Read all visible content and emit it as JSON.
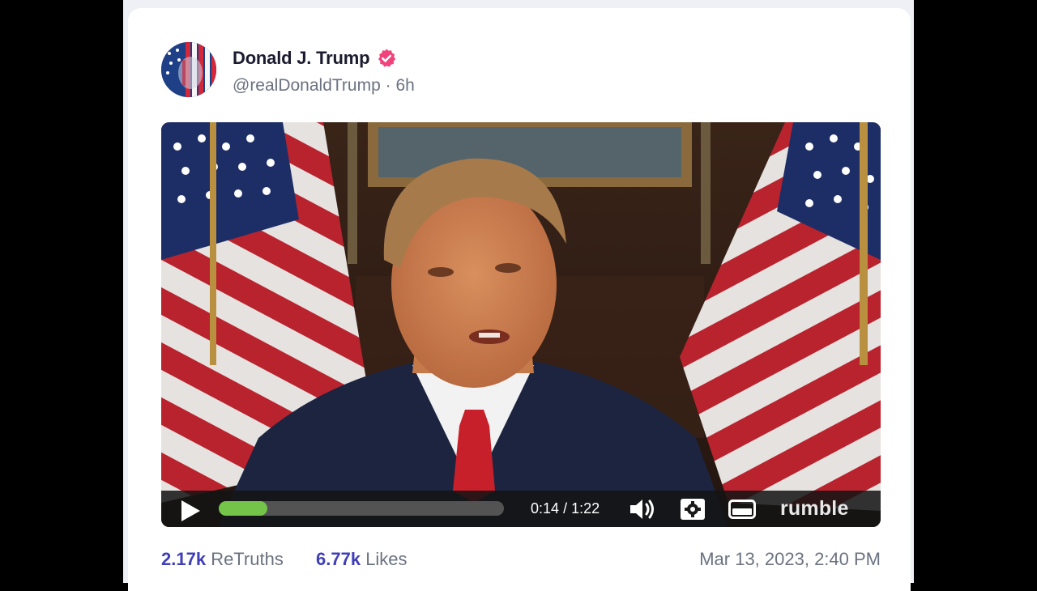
{
  "post": {
    "author": {
      "display_name": "Donald J. Trump",
      "handle": "@realDonaldTrump",
      "separator": "·",
      "age": "6h",
      "verified_icon": "verified-badge-icon",
      "verified_color": "#f0437b"
    },
    "video": {
      "current_time": "0:14",
      "time_separator": "/",
      "duration": "1:22",
      "progress_fraction": 0.17,
      "brand": "rumble",
      "icons": {
        "play": "play-icon",
        "volume": "volume-icon",
        "settings": "gear-icon",
        "pip": "picture-in-picture-icon"
      },
      "progress_color": "#74c44a"
    },
    "stats": {
      "retruths_count": "2.17k",
      "retruths_label": "ReTruths",
      "likes_count": "6.77k",
      "likes_label": "Likes"
    },
    "timestamp": "Mar 13, 2023, 2:40 PM",
    "accent_color": "#3f3fb8"
  }
}
